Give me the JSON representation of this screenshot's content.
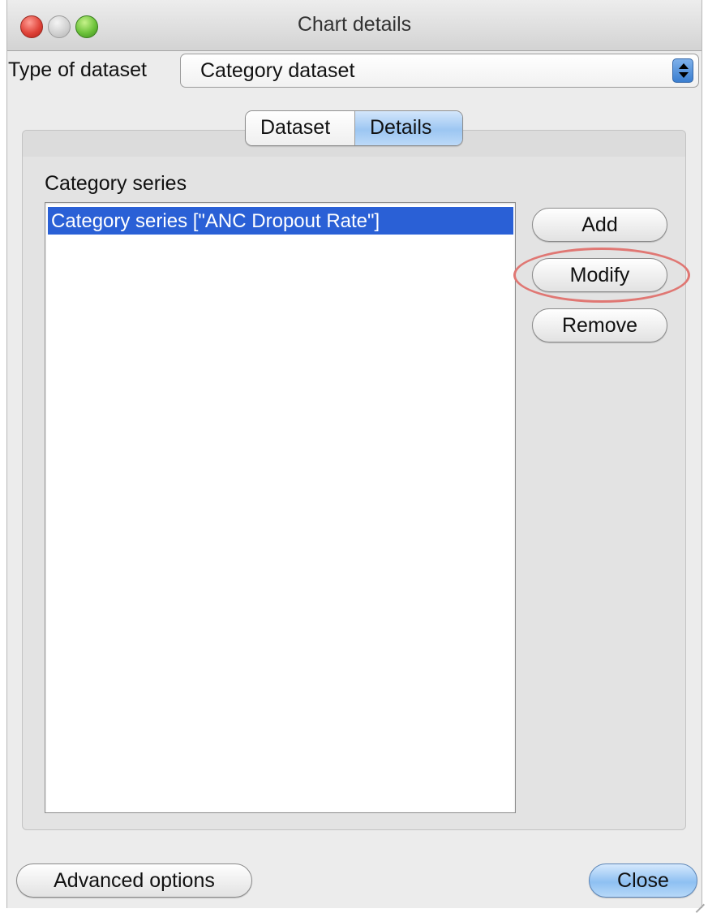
{
  "window": {
    "title": "Chart details",
    "traffic_lights": [
      "close",
      "minimize",
      "zoom"
    ]
  },
  "dataset_type": {
    "label": "Type of dataset",
    "selected": "Category dataset"
  },
  "tabs": [
    {
      "label": "Dataset",
      "selected": false
    },
    {
      "label": "Details",
      "selected": true
    }
  ],
  "series": {
    "label": "Category series",
    "items": [
      {
        "label": "Category series [\"ANC Dropout Rate\"]",
        "selected": true
      }
    ]
  },
  "actions": {
    "add": "Add",
    "modify": "Modify",
    "remove": "Remove"
  },
  "footer": {
    "advanced": "Advanced options",
    "close": "Close"
  },
  "colors": {
    "selection": "#2a60d6",
    "highlight_ring": "#e07773",
    "accent_blue": "#9cc6f2"
  }
}
